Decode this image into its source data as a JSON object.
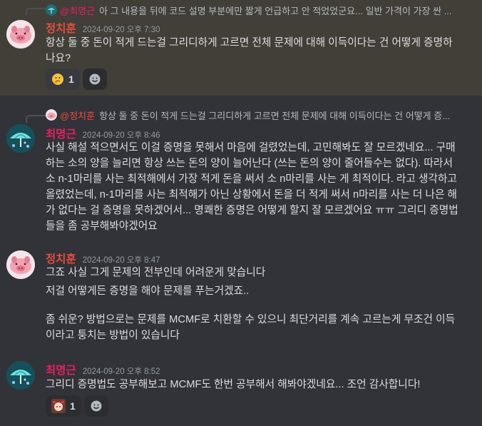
{
  "messages": [
    {
      "reply": {
        "author": "@최명근",
        "text": "아 그 내용을 뒤에 코드 설명 부분에만 짧게 언급하고 안 적었었군요... 일반 가격이 가장 싼 ..."
      },
      "author": "정치훈",
      "author_color": "#e74c3c",
      "timestamp": "2024-09-20 오후 7:30",
      "avatar": "pink-pig-avatar",
      "paragraphs": [
        "항상 둘 중 돈이 적게 드는걸 그리디하게 고르면 전체 문제에 대해 이득이다는 건 어떻게 증명하나요?"
      ],
      "reactions": [
        {
          "emoji": "thinking-face",
          "count": "1"
        }
      ],
      "highlighted": true
    },
    {
      "reply": {
        "author": "@정치훈",
        "text": "항상 둘 중 돈이 적게 드는걸 그리디하게 고르면 전체 문제에 대해 이득이다는 건 어떻게 증..."
      },
      "author": "최명근",
      "author_color": "#e91e63",
      "timestamp": "2024-09-20 오후 8:46",
      "avatar": "umbrella-avatar",
      "paragraphs": [
        "사실 해설 적으면서도 이걸 증명을 못해서 마음에 걸렸었는데, 고민해봐도 잘 모르겠네요... 구매하는 소의 양을 늘리면 항상 쓰는 돈의 양이 늘어난다 (쓰는 돈의 양이 줄어들수는 없다). 따라서 소 n-1마리를 사는 최적해에서 가장 적게 돈을 써서 소 n마리를 사는 게 최적이다. 라고 생각하고 올렸었는데, n-1마리를 사는 최적해가 아닌 상황에서 돈을 더 적게 써서 n마리를 사는 더 나은 해가 없다는 걸 증명을 못하겠어서... 명쾌한 증명은 어떻게 할지 잘 모르겠어요 ㅠㅠ 그리디 증명법들을 좀 공부해봐야겠어요"
      ]
    },
    {
      "author": "정치훈",
      "author_color": "#e74c3c",
      "timestamp": "2024-09-20 오후 8:47",
      "avatar": "pink-pig-avatar",
      "paragraphs": [
        "그죠 사실 그게 문제의 전부인데 어려운게 맞습니다",
        "저걸 어떻게든 증명을 해야 문제를 푸는거겠죠..",
        "좀 쉬운? 방법으로는 문제를 MCMF로 치환할 수 있으니 최단거리를 계속 고르는게 무조건 이득이라고 퉁치는 방법이 있습니다"
      ]
    },
    {
      "author": "최명근",
      "author_color": "#e91e63",
      "timestamp": "2024-09-20 오후 8:52",
      "avatar": "umbrella-avatar",
      "paragraphs": [
        "그리디 증명법도 공부해보고 MCMF도 한번 공부해서 해봐야겠네요... 조언 감사합니다!"
      ],
      "reactions": [
        {
          "emoji": "anime-girl-sticker",
          "count": "1"
        }
      ]
    }
  ],
  "add_reaction_icon": "smiley-add-icon"
}
